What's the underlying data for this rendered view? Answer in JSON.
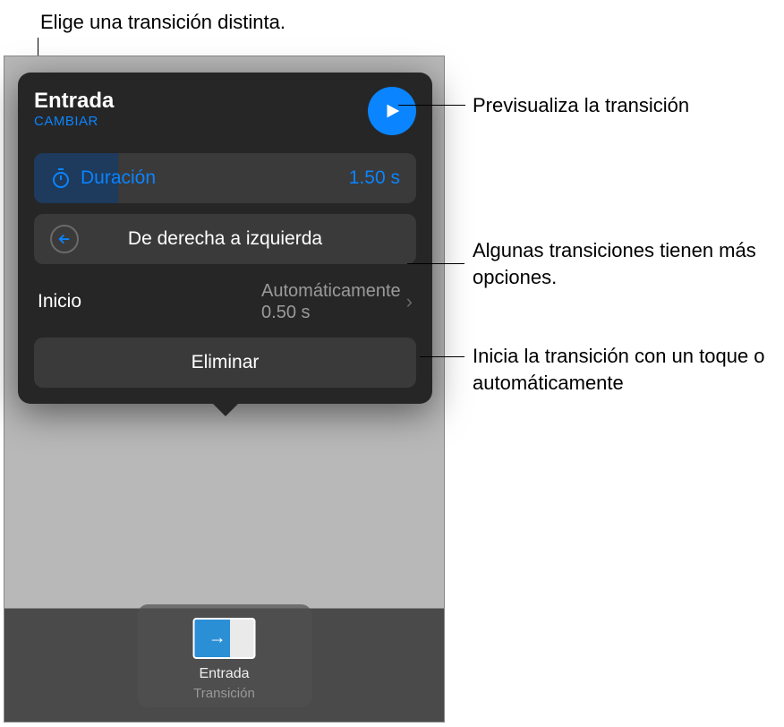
{
  "annotations": {
    "top": "Elige una transición distinta.",
    "preview": "Previsualiza la transición",
    "options": "Algunas transiciones tienen más opciones.",
    "start": "Inicia la transición con un toque o automáticamente"
  },
  "popover": {
    "title": "Entrada",
    "change_label": "CAMBIAR",
    "duration": {
      "label": "Duración",
      "value": "1.50 s"
    },
    "direction": {
      "label": "De derecha a izquierda"
    },
    "start": {
      "label": "Inicio",
      "mode": "Automáticamente",
      "delay": "0.50 s"
    },
    "delete_label": "Eliminar"
  },
  "tile": {
    "title": "Entrada",
    "subtitle": "Transición"
  }
}
